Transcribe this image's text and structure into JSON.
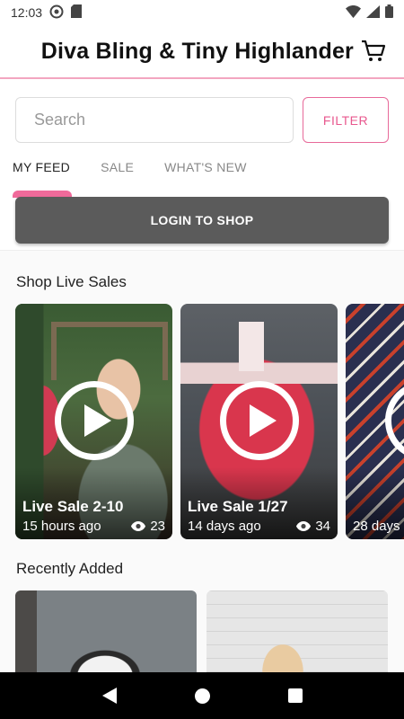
{
  "status_bar": {
    "time": "12:03"
  },
  "header": {
    "store_title": "Diva Bling & Tiny Highlander"
  },
  "search": {
    "placeholder": "Search",
    "value": ""
  },
  "filter": {
    "label": "FILTER"
  },
  "tabs": [
    {
      "label": "MY FEED",
      "active": true
    },
    {
      "label": "SALE",
      "active": false
    },
    {
      "label": "WHAT'S NEW",
      "active": false
    }
  ],
  "login": {
    "label": "LOGIN TO SHOP"
  },
  "live_sales": {
    "title": "Shop Live Sales",
    "items": [
      {
        "title": "Live Sale 2-10",
        "time": "15 hours ago",
        "views": "23"
      },
      {
        "title": "Live Sale 1/27",
        "time": "14 days ago",
        "views": "34"
      },
      {
        "title": "",
        "time": "28 days",
        "views": ""
      }
    ]
  },
  "recently_added": {
    "title": "Recently Added"
  },
  "colors": {
    "accent": "#f06a9a",
    "login_bg": "#5b5b5b"
  }
}
